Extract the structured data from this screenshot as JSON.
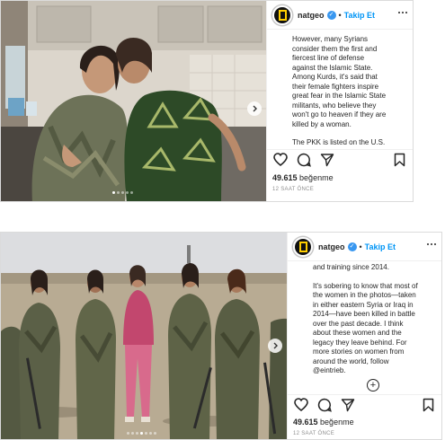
{
  "post1": {
    "username": "natgeo",
    "separator": "•",
    "follow_label": "Takip Et",
    "caption_paragraphs": [
      "However, many Syrians consider them the first and fiercest line of defense against the Islamic State. Among Kurds, it's said that their female fighters inspire great fear in the Islamic State militants, who believe they won't go to heaven if they are killed by a woman.",
      "The PKK is listed on the U.S. State Department's list of Foreign Terrorist Organizations, but given YPJ's role in fighting the Islamic State, the U.S. also"
    ],
    "likes_count": "49.615",
    "likes_label": "beğenme",
    "time_ago": "12 SAAT ÖNCE",
    "carousel": {
      "count": 5,
      "active": 1
    }
  },
  "post2": {
    "username": "natgeo",
    "separator": "•",
    "follow_label": "Takip Et",
    "caption_paragraphs": [
      "and training since 2014.",
      "It's sobering to know that most of the women in the photos—taken in either eastern Syria or Iraq in 2014—have been killed in battle over the past decade. I think about these women and the legacy they leave behind. For more stories on women from around the world, follow @eintrieb."
    ],
    "caption_time": "12s",
    "likes_count": "49.615",
    "likes_label": "beğenme",
    "time_ago": "12 SAAT ÖNCE",
    "carousel": {
      "count": 7,
      "active": 4
    }
  },
  "icons": {
    "like": "heart-icon",
    "comment": "comment-icon",
    "share": "share-icon",
    "save": "bookmark-icon",
    "more": "more-options-icon",
    "next": "chevron-right-icon",
    "add_comment": "plus-circle-icon"
  },
  "colors": {
    "accent_blue": "#0095f6",
    "verified_blue": "#3897f0",
    "text": "#262626",
    "muted": "#8e8e8e",
    "border": "#dbdbdb",
    "avatar_frame": "#ffce00"
  }
}
